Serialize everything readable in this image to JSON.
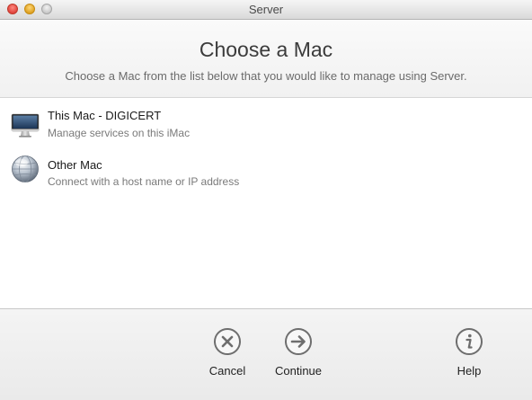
{
  "window": {
    "title": "Server"
  },
  "header": {
    "title": "Choose a Mac",
    "subtitle": "Choose a Mac from the list below that you would like to manage using Server."
  },
  "list": {
    "items": [
      {
        "title": "This Mac - DIGICERT",
        "subtitle": "Manage services on this iMac",
        "icon": "imac-icon"
      },
      {
        "title": "Other Mac",
        "subtitle": "Connect with a host name or IP address",
        "icon": "network-globe-icon"
      }
    ]
  },
  "buttons": {
    "cancel": "Cancel",
    "continue": "Continue",
    "help": "Help"
  }
}
